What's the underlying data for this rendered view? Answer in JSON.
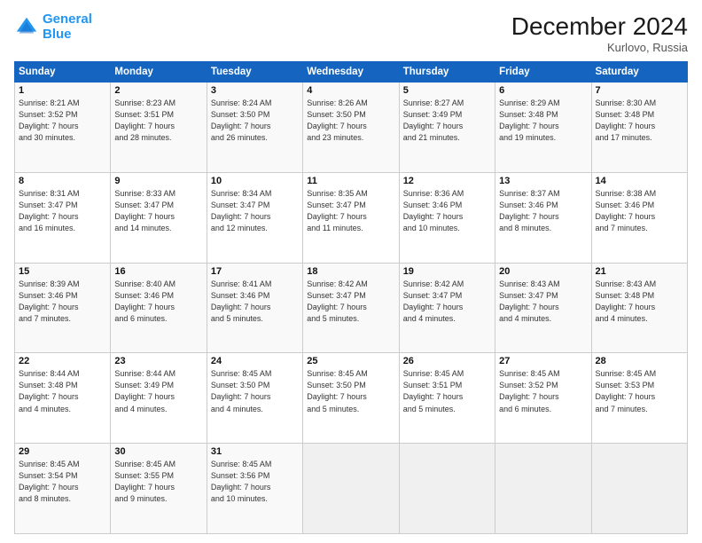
{
  "logo": {
    "line1": "General",
    "line2": "Blue"
  },
  "title": "December 2024",
  "location": "Kurlovo, Russia",
  "days_header": [
    "Sunday",
    "Monday",
    "Tuesday",
    "Wednesday",
    "Thursday",
    "Friday",
    "Saturday"
  ],
  "weeks": [
    [
      {
        "day": "1",
        "lines": [
          "Sunrise: 8:21 AM",
          "Sunset: 3:52 PM",
          "Daylight: 7 hours",
          "and 30 minutes."
        ]
      },
      {
        "day": "2",
        "lines": [
          "Sunrise: 8:23 AM",
          "Sunset: 3:51 PM",
          "Daylight: 7 hours",
          "and 28 minutes."
        ]
      },
      {
        "day": "3",
        "lines": [
          "Sunrise: 8:24 AM",
          "Sunset: 3:50 PM",
          "Daylight: 7 hours",
          "and 26 minutes."
        ]
      },
      {
        "day": "4",
        "lines": [
          "Sunrise: 8:26 AM",
          "Sunset: 3:50 PM",
          "Daylight: 7 hours",
          "and 23 minutes."
        ]
      },
      {
        "day": "5",
        "lines": [
          "Sunrise: 8:27 AM",
          "Sunset: 3:49 PM",
          "Daylight: 7 hours",
          "and 21 minutes."
        ]
      },
      {
        "day": "6",
        "lines": [
          "Sunrise: 8:29 AM",
          "Sunset: 3:48 PM",
          "Daylight: 7 hours",
          "and 19 minutes."
        ]
      },
      {
        "day": "7",
        "lines": [
          "Sunrise: 8:30 AM",
          "Sunset: 3:48 PM",
          "Daylight: 7 hours",
          "and 17 minutes."
        ]
      }
    ],
    [
      {
        "day": "8",
        "lines": [
          "Sunrise: 8:31 AM",
          "Sunset: 3:47 PM",
          "Daylight: 7 hours",
          "and 16 minutes."
        ]
      },
      {
        "day": "9",
        "lines": [
          "Sunrise: 8:33 AM",
          "Sunset: 3:47 PM",
          "Daylight: 7 hours",
          "and 14 minutes."
        ]
      },
      {
        "day": "10",
        "lines": [
          "Sunrise: 8:34 AM",
          "Sunset: 3:47 PM",
          "Daylight: 7 hours",
          "and 12 minutes."
        ]
      },
      {
        "day": "11",
        "lines": [
          "Sunrise: 8:35 AM",
          "Sunset: 3:47 PM",
          "Daylight: 7 hours",
          "and 11 minutes."
        ]
      },
      {
        "day": "12",
        "lines": [
          "Sunrise: 8:36 AM",
          "Sunset: 3:46 PM",
          "Daylight: 7 hours",
          "and 10 minutes."
        ]
      },
      {
        "day": "13",
        "lines": [
          "Sunrise: 8:37 AM",
          "Sunset: 3:46 PM",
          "Daylight: 7 hours",
          "and 8 minutes."
        ]
      },
      {
        "day": "14",
        "lines": [
          "Sunrise: 8:38 AM",
          "Sunset: 3:46 PM",
          "Daylight: 7 hours",
          "and 7 minutes."
        ]
      }
    ],
    [
      {
        "day": "15",
        "lines": [
          "Sunrise: 8:39 AM",
          "Sunset: 3:46 PM",
          "Daylight: 7 hours",
          "and 7 minutes."
        ]
      },
      {
        "day": "16",
        "lines": [
          "Sunrise: 8:40 AM",
          "Sunset: 3:46 PM",
          "Daylight: 7 hours",
          "and 6 minutes."
        ]
      },
      {
        "day": "17",
        "lines": [
          "Sunrise: 8:41 AM",
          "Sunset: 3:46 PM",
          "Daylight: 7 hours",
          "and 5 minutes."
        ]
      },
      {
        "day": "18",
        "lines": [
          "Sunrise: 8:42 AM",
          "Sunset: 3:47 PM",
          "Daylight: 7 hours",
          "and 5 minutes."
        ]
      },
      {
        "day": "19",
        "lines": [
          "Sunrise: 8:42 AM",
          "Sunset: 3:47 PM",
          "Daylight: 7 hours",
          "and 4 minutes."
        ]
      },
      {
        "day": "20",
        "lines": [
          "Sunrise: 8:43 AM",
          "Sunset: 3:47 PM",
          "Daylight: 7 hours",
          "and 4 minutes."
        ]
      },
      {
        "day": "21",
        "lines": [
          "Sunrise: 8:43 AM",
          "Sunset: 3:48 PM",
          "Daylight: 7 hours",
          "and 4 minutes."
        ]
      }
    ],
    [
      {
        "day": "22",
        "lines": [
          "Sunrise: 8:44 AM",
          "Sunset: 3:48 PM",
          "Daylight: 7 hours",
          "and 4 minutes."
        ]
      },
      {
        "day": "23",
        "lines": [
          "Sunrise: 8:44 AM",
          "Sunset: 3:49 PM",
          "Daylight: 7 hours",
          "and 4 minutes."
        ]
      },
      {
        "day": "24",
        "lines": [
          "Sunrise: 8:45 AM",
          "Sunset: 3:50 PM",
          "Daylight: 7 hours",
          "and 4 minutes."
        ]
      },
      {
        "day": "25",
        "lines": [
          "Sunrise: 8:45 AM",
          "Sunset: 3:50 PM",
          "Daylight: 7 hours",
          "and 5 minutes."
        ]
      },
      {
        "day": "26",
        "lines": [
          "Sunrise: 8:45 AM",
          "Sunset: 3:51 PM",
          "Daylight: 7 hours",
          "and 5 minutes."
        ]
      },
      {
        "day": "27",
        "lines": [
          "Sunrise: 8:45 AM",
          "Sunset: 3:52 PM",
          "Daylight: 7 hours",
          "and 6 minutes."
        ]
      },
      {
        "day": "28",
        "lines": [
          "Sunrise: 8:45 AM",
          "Sunset: 3:53 PM",
          "Daylight: 7 hours",
          "and 7 minutes."
        ]
      }
    ],
    [
      {
        "day": "29",
        "lines": [
          "Sunrise: 8:45 AM",
          "Sunset: 3:54 PM",
          "Daylight: 7 hours",
          "and 8 minutes."
        ]
      },
      {
        "day": "30",
        "lines": [
          "Sunrise: 8:45 AM",
          "Sunset: 3:55 PM",
          "Daylight: 7 hours",
          "and 9 minutes."
        ]
      },
      {
        "day": "31",
        "lines": [
          "Sunrise: 8:45 AM",
          "Sunset: 3:56 PM",
          "Daylight: 7 hours",
          "and 10 minutes."
        ]
      },
      {
        "day": "",
        "lines": []
      },
      {
        "day": "",
        "lines": []
      },
      {
        "day": "",
        "lines": []
      },
      {
        "day": "",
        "lines": []
      }
    ]
  ]
}
